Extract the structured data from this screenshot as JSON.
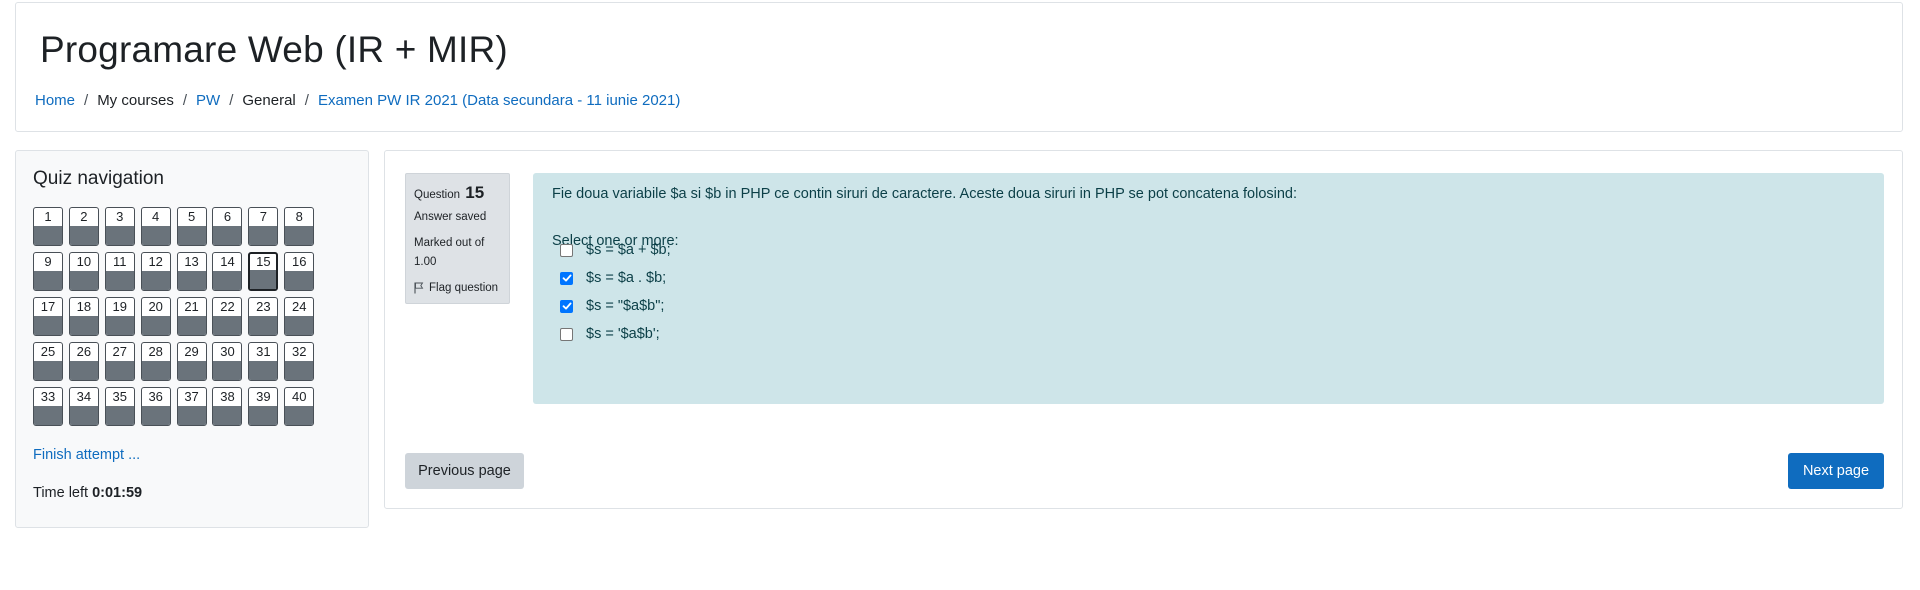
{
  "header": {
    "course_title": "Programare Web (IR + MIR)",
    "breadcrumb": [
      {
        "label": "Home",
        "link": true
      },
      {
        "label": "My courses",
        "link": false
      },
      {
        "label": "PW",
        "link": true
      },
      {
        "label": "General",
        "link": false
      },
      {
        "label": "Examen PW IR 2021 (Data secundara - 11 iunie 2021)",
        "link": true
      }
    ],
    "separator": "/"
  },
  "quiz_navigation": {
    "title": "Quiz navigation",
    "questions": [
      "1",
      "2",
      "3",
      "4",
      "5",
      "6",
      "7",
      "8",
      "9",
      "10",
      "11",
      "12",
      "13",
      "14",
      "15",
      "16",
      "17",
      "18",
      "19",
      "20",
      "21",
      "22",
      "23",
      "24",
      "25",
      "26",
      "27",
      "28",
      "29",
      "30",
      "31",
      "32",
      "33",
      "34",
      "35",
      "36",
      "37",
      "38",
      "39",
      "40"
    ],
    "current_question": "15",
    "finish_label": "Finish attempt ...",
    "time_left_label": "Time left",
    "time_left_value": "0:01:59"
  },
  "question": {
    "label": "Question",
    "number": "15",
    "state": "Answer saved",
    "grade_line1": "Marked out of",
    "grade_line2": "1.00",
    "flag_label": "Flag question",
    "text": "Fie doua variabile $a si $b in PHP ce contin siruri de caractere. Aceste doua siruri in PHP se pot concatena folosind:",
    "prompt": "Select one or more:",
    "options": [
      {
        "label": "$s = $a + $b;",
        "checked": false
      },
      {
        "label": "$s = $a . $b;",
        "checked": true
      },
      {
        "label": "$s = \"$a$b\";",
        "checked": true
      },
      {
        "label": "$s = '$a$b';",
        "checked": false
      }
    ]
  },
  "buttons": {
    "previous": "Previous page",
    "next": "Next page"
  },
  "colors": {
    "link": "#0f6cbf",
    "primary_button": "#0f6cbf",
    "secondary_button": "#ced4da",
    "question_box": "#cee5e9",
    "answered_fill": "#6a737b"
  }
}
